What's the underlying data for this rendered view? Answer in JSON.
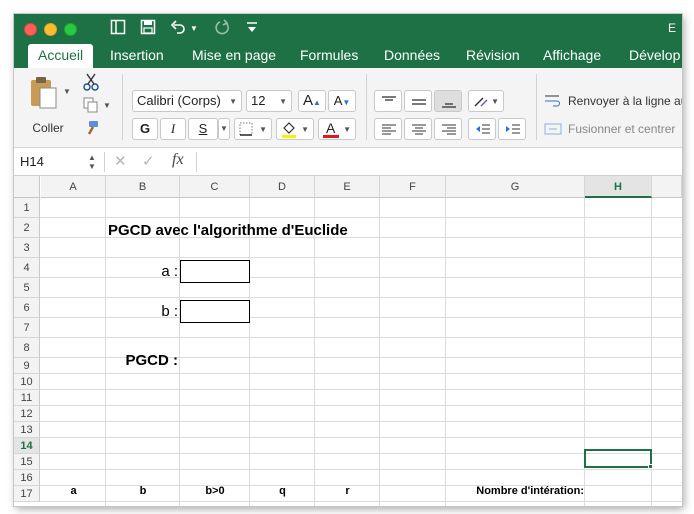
{
  "title_fragment": "E",
  "tabs": [
    "Accueil",
    "Insertion",
    "Mise en page",
    "Formules",
    "Données",
    "Révision",
    "Affichage",
    "Dévelop"
  ],
  "ribbon": {
    "paste_label": "Coller",
    "font_name": "Calibri (Corps)",
    "font_size": "12",
    "bold": "G",
    "italic": "I",
    "underline": "S",
    "wrap_text": "Renvoyer à la ligne aut",
    "merge_center": "Fusionner et centrer"
  },
  "formula_bar": {
    "name_box": "H14",
    "fx": "fx"
  },
  "columns": [
    "A",
    "B",
    "C",
    "D",
    "E",
    "F",
    "G",
    "H"
  ],
  "selected_column": "H",
  "rows": [
    "1",
    "2",
    "3",
    "4",
    "5",
    "6",
    "7",
    "8",
    "9",
    "10",
    "11",
    "12",
    "13",
    "14",
    "15",
    "16",
    "17"
  ],
  "selected_row": "14",
  "cells": {
    "title": "PGCD avec l'algorithme d'Euclide",
    "a_label": "a :",
    "b_label": "b :",
    "pgcd_label": "PGCD :",
    "hdr_a": "a",
    "hdr_b": "b",
    "hdr_bgt0": "b>0",
    "hdr_q": "q",
    "hdr_r": "r",
    "hdr_iterations": "Nombre d'intération:"
  }
}
